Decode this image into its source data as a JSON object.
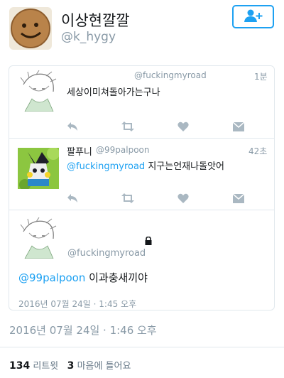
{
  "profile": {
    "display_name": "이상현깔깔",
    "screen_name": "@k_hygy",
    "follow_icon": "add-user-icon"
  },
  "thread": [
    {
      "handle": "@fuckingmyroad",
      "time": "1분",
      "text": "세상이미쳐돌아가는구나"
    },
    {
      "name": "팔푸니",
      "handle": "@99palpoon",
      "time": "42초",
      "mention": "@fuckingmyroad",
      "text": " 지구는언재나돌앗어"
    },
    {
      "handle": "@fuckingmyroad",
      "mention": "@99palpoon",
      "text": " 이과충새끼야",
      "date": "2016년 07월 24일 · 1:45 오후"
    }
  ],
  "detail": {
    "date": "2016년 07월 24일 · 1:46 오후",
    "retweets_count": "134",
    "retweets_label": "리트윗",
    "likes_count": "3",
    "likes_label": "마음에 들어요"
  },
  "icons": [
    "reply-icon",
    "retweet-icon",
    "like-icon",
    "message-icon",
    "lock-icon"
  ],
  "colors": {
    "accent": "#1da1f2",
    "muted": "#8899a6",
    "action": "#aab8c2"
  }
}
